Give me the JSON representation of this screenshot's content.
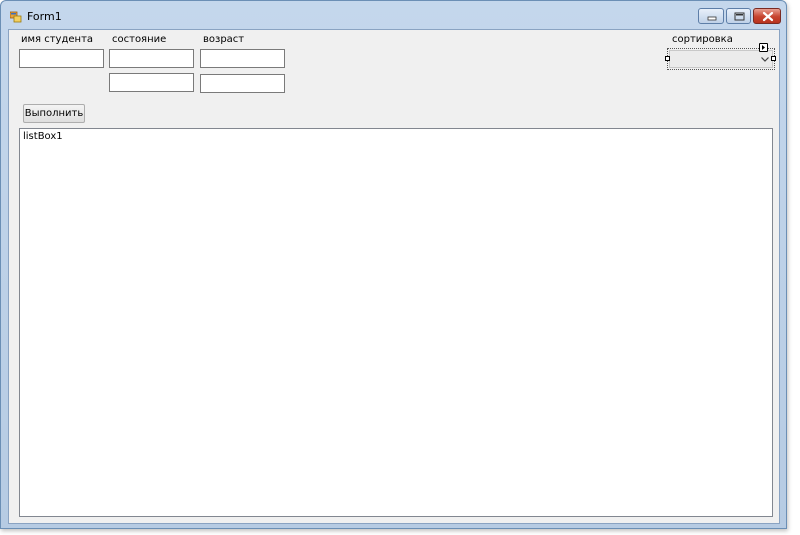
{
  "window": {
    "title": "Form1",
    "icon": "winforms-app-icon",
    "controls": [
      "minimize-icon",
      "maximize-icon",
      "close-icon"
    ]
  },
  "labels": {
    "student_name": "имя студента",
    "state": "состояние",
    "age": "возраст",
    "sort": "сортировка"
  },
  "inputs": {
    "student_name": {
      "value": "",
      "placeholder": ""
    },
    "state_1": {
      "value": "",
      "placeholder": ""
    },
    "state_2": {
      "value": "",
      "placeholder": ""
    },
    "age_1": {
      "value": "",
      "placeholder": ""
    },
    "age_2": {
      "value": "",
      "placeholder": ""
    }
  },
  "sort_combo": {
    "selected": ""
  },
  "execute_button": {
    "label": "Выполнить"
  },
  "listbox": {
    "items": [
      "listBox1"
    ]
  },
  "colors": {
    "titlebar": "#c4d7ec",
    "client": "#f0f0f0",
    "close_button": "#c7442f"
  }
}
